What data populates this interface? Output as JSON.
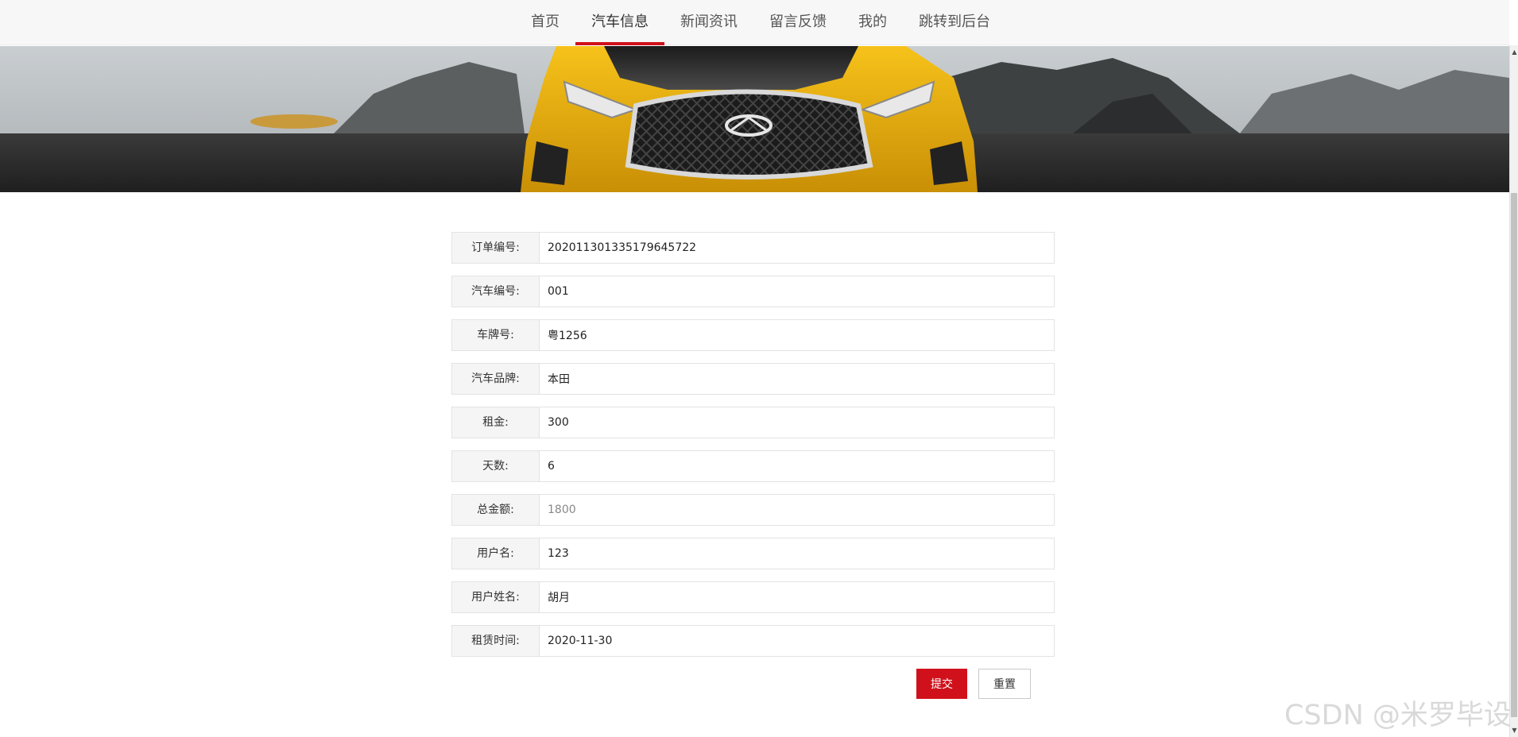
{
  "nav": {
    "items": [
      {
        "label": "首页",
        "active": false
      },
      {
        "label": "汽车信息",
        "active": true
      },
      {
        "label": "新闻资讯",
        "active": false
      },
      {
        "label": "留言反馈",
        "active": false
      },
      {
        "label": "我的",
        "active": false
      },
      {
        "label": "跳转到后台",
        "active": false
      }
    ],
    "accent_color": "#d0111b"
  },
  "banner": {
    "image": "yellow-sports-car-front"
  },
  "form": {
    "fields": [
      {
        "label": "订单编号:",
        "value": "202011301335179645722"
      },
      {
        "label": "汽车编号:",
        "value": "001"
      },
      {
        "label": "车牌号:",
        "value": "粤1256"
      },
      {
        "label": "汽车品牌:",
        "value": "本田"
      },
      {
        "label": "租金:",
        "value": "300"
      },
      {
        "label": "天数:",
        "value": "6"
      },
      {
        "label": "总金额:",
        "value": "1800"
      },
      {
        "label": "用户名:",
        "value": "123"
      },
      {
        "label": "用户姓名:",
        "value": "胡月"
      },
      {
        "label": "租赁时间:",
        "value": "2020-11-30"
      }
    ],
    "submit_label": "提交",
    "reset_label": "重置"
  },
  "watermark": "CSDN @米罗毕设"
}
